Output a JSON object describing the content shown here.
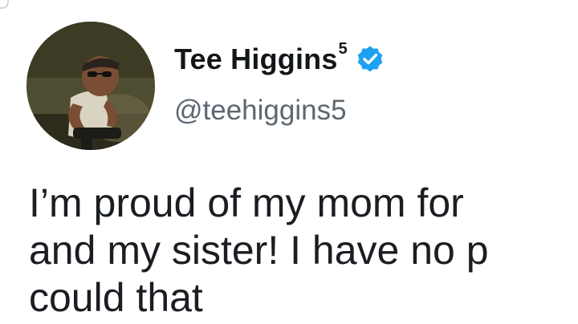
{
  "user": {
    "display_name": "Tee Higgins",
    "name_superscript": "5",
    "handle": "@teehiggins5",
    "verified_icon": "verified-badge-icon",
    "verified_color": "#1da1f2"
  },
  "tweet": {
    "lines": [
      "I’m proud of my mom for",
      "and my sister! I have no p",
      "could that"
    ]
  }
}
